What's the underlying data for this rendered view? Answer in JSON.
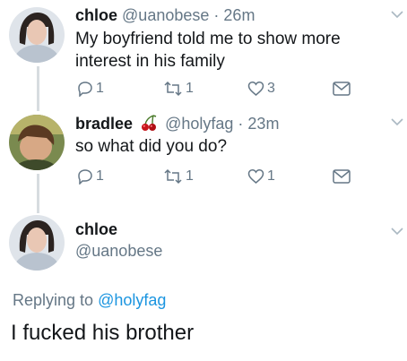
{
  "tweets": [
    {
      "name": "chloe",
      "handle": "@uanobese",
      "separator": "·",
      "time": "26m",
      "text_lines": [
        "My boyfriend told me to show more",
        "interest in his family"
      ],
      "replies": "1",
      "retweets": "1",
      "likes": "3"
    },
    {
      "name": "bradlee",
      "emoji": "cherries-icon",
      "handle": "@holyfag",
      "separator": "·",
      "time": "23m",
      "text_lines": [
        "so what did you do?"
      ],
      "replies": "1",
      "retweets": "1",
      "likes": "1"
    }
  ],
  "main_tweet": {
    "name": "chloe",
    "handle": "@uanobese",
    "replying_prefix": "Replying to",
    "replying_handle": "@holyfag",
    "text": "I fucked his brother"
  },
  "colors": {
    "muted": "#657786",
    "link": "#1b95e0",
    "thread_line": "#d7dce0"
  }
}
